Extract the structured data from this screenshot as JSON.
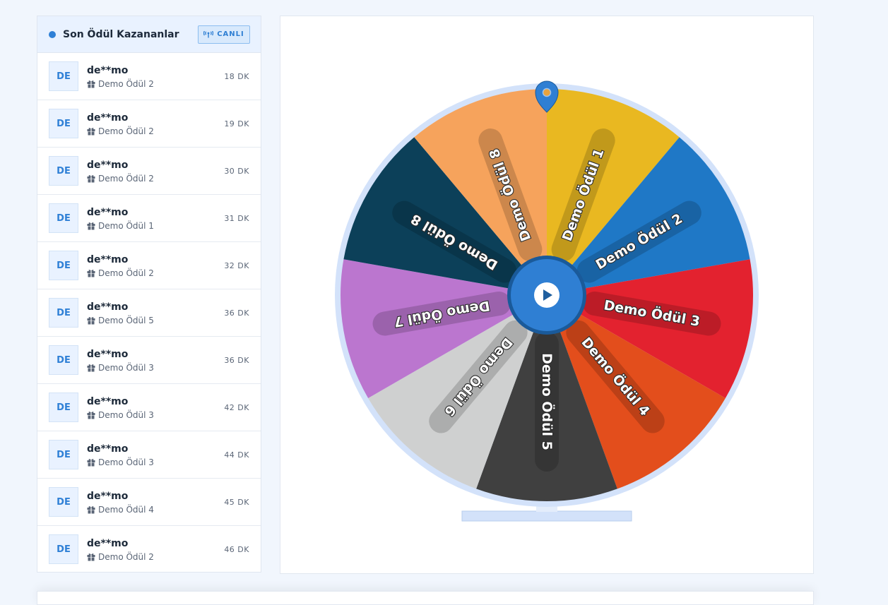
{
  "sidebar": {
    "title": "Son Ödül Kazananlar",
    "live_label": "CANLI",
    "winners": [
      {
        "avatar": "DE",
        "user": "de**mo",
        "prize": "Demo Ödül 2",
        "time": "18 DK"
      },
      {
        "avatar": "DE",
        "user": "de**mo",
        "prize": "Demo Ödül 2",
        "time": "19 DK"
      },
      {
        "avatar": "DE",
        "user": "de**mo",
        "prize": "Demo Ödül 2",
        "time": "30 DK"
      },
      {
        "avatar": "DE",
        "user": "de**mo",
        "prize": "Demo Ödül 1",
        "time": "31 DK"
      },
      {
        "avatar": "DE",
        "user": "de**mo",
        "prize": "Demo Ödül 2",
        "time": "32 DK"
      },
      {
        "avatar": "DE",
        "user": "de**mo",
        "prize": "Demo Ödül 5",
        "time": "36 DK"
      },
      {
        "avatar": "DE",
        "user": "de**mo",
        "prize": "Demo Ödül 3",
        "time": "36 DK"
      },
      {
        "avatar": "DE",
        "user": "de**mo",
        "prize": "Demo Ödül 3",
        "time": "42 DK"
      },
      {
        "avatar": "DE",
        "user": "de**mo",
        "prize": "Demo Ödül 3",
        "time": "44 DK"
      },
      {
        "avatar": "DE",
        "user": "de**mo",
        "prize": "Demo Ödül 4",
        "time": "45 DK"
      },
      {
        "avatar": "DE",
        "user": "de**mo",
        "prize": "Demo Ödül 2",
        "time": "46 DK"
      }
    ]
  },
  "wheel": {
    "segments": [
      {
        "label": "Demo Ödül 1",
        "color": "#e9b821"
      },
      {
        "label": "Demo Ödül 2",
        "color": "#1f78c6"
      },
      {
        "label": "Demo Ödül 3",
        "color": "#e3222f"
      },
      {
        "label": "Demo Ödül 4",
        "color": "#e34e1c"
      },
      {
        "label": "Demo Ödül 5",
        "color": "#404040"
      },
      {
        "label": "Demo Ödül 6",
        "color": "#cfd0d0"
      },
      {
        "label": "Demo Ödül 7",
        "color": "#bb76cf"
      },
      {
        "label": "Demo Ödül 8",
        "color": "#0c4059"
      },
      {
        "label": "Demo Ödül 8",
        "color": "#f6a35c"
      }
    ],
    "rim_color": "#d3e2fa",
    "hub_color": "#2f7fd3",
    "pointer_color": "#2f7fd3",
    "play_icon": "play-icon",
    "pointer_icon": "map-pin-icon"
  },
  "icons": {
    "live": "broadcast-icon",
    "prize": "gift-icon"
  }
}
